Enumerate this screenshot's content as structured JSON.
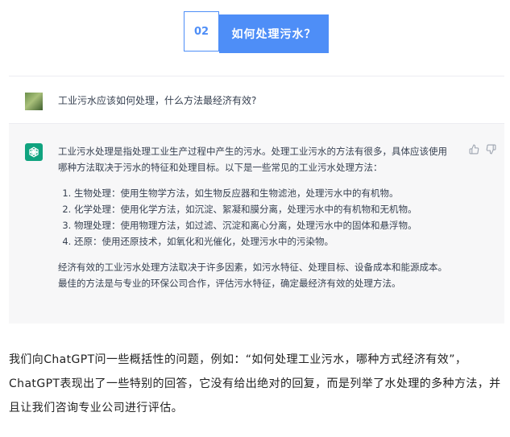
{
  "header": {
    "number": "02",
    "title": "如何处理污水？"
  },
  "question": {
    "text": "工业污水应该如何处理，什么方法最经济有效?"
  },
  "answer": {
    "intro": "工业污水处理是指处理工业生产过程中产生的污水。处理工业污水的方法有很多，具体应该使用哪种方法取决于污水的特征和处理目标。以下是一些常见的工业污水处理方法：",
    "items": [
      "生物处理：使用生物学方法，如生物反应器和生物滤池，处理污水中的有机物。",
      "化学处理：使用化学方法，如沉淀、絮凝和膜分离，处理污水中的有机物和无机物。",
      "物理处理：使用物理方法，如过滤、沉淀和离心分离，处理污水中的固体和悬浮物。",
      "还原：使用还原技术，如氧化和光催化，处理污水中的污染物。"
    ],
    "conclusion": "经济有效的工业污水处理方法取决于许多因素，如污水特征、处理目标、设备成本和能源成本。最佳的方法是与专业的环保公司合作，评估污水特征，确定最经济有效的处理方法。"
  },
  "icons": {
    "avatar": "user-avatar",
    "assistant": "chatgpt-logo-icon",
    "like": "thumbs-up-icon",
    "dislike": "thumbs-down-icon"
  },
  "colors": {
    "accent": "#4e8ef7",
    "gpt_green": "#10a37f"
  },
  "body": {
    "paragraph": "我们向ChatGPT问一些概括性的问题，例如：“如何处理工业污水，哪种方式经济有效”，ChatGPT表现出了一些特别的回答，它没有给出绝对的回复，而是列举了水处理的多种方法，并且让我们咨询专业公司进行评估。"
  }
}
